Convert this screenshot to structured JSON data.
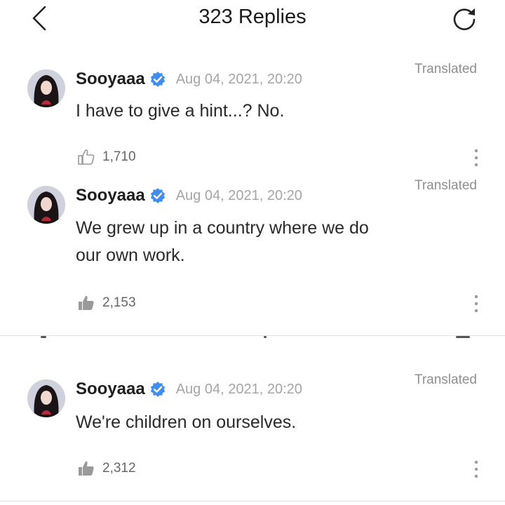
{
  "header": {
    "title": "323 Replies",
    "back_icon": "chevron-left-icon",
    "refresh_icon": "refresh-icon"
  },
  "replies": [
    {
      "username": "Sooyaaa",
      "verified": true,
      "timestamp": "Aug 04, 2021, 20:20",
      "translated_label": "Translated",
      "text": "I have to give a hint...? No.",
      "likes": "1,710",
      "liked_icon": "thumbs-up-outline-icon"
    },
    {
      "username": "Sooyaaa",
      "verified": true,
      "timestamp": "Aug 04, 2021, 20:20",
      "translated_label": "Translated",
      "text": "We grew up in a country where we do our own work.",
      "likes": "2,153",
      "liked_icon": "thumbs-up-filled-icon"
    },
    {
      "username": "Sooyaaa",
      "verified": true,
      "timestamp": "Aug 04, 2021, 20:20",
      "translated_label": "Translated",
      "text": "We're children on ourselves.",
      "likes": "2,312",
      "liked_icon": "thumbs-up-filled-icon"
    }
  ],
  "colors": {
    "verified_badge": "#3d8ef0",
    "text_primary": "#2a2a2a",
    "text_muted": "#a5a5a5"
  }
}
